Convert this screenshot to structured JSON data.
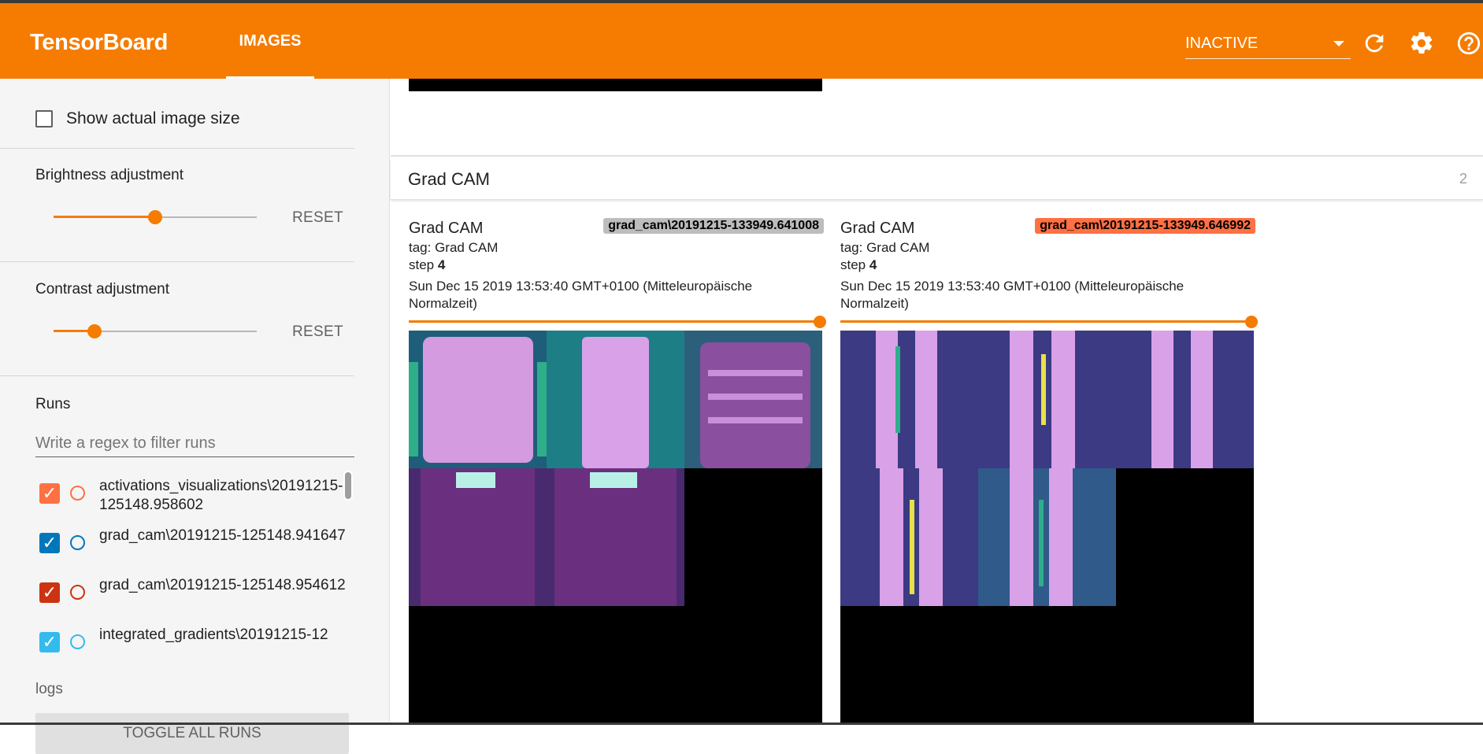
{
  "header": {
    "brand": "TensorBoard",
    "tabs": [
      {
        "label": "IMAGES",
        "active": true
      }
    ],
    "run_status": "INACTIVE",
    "icons": [
      "refresh-icon",
      "settings-icon",
      "help-icon"
    ],
    "colors": {
      "primary": "#f57c00",
      "on_primary": "#ffffff"
    }
  },
  "sidebar": {
    "show_actual_size_label": "Show actual image size",
    "show_actual_size_checked": false,
    "brightness": {
      "label": "Brightness adjustment",
      "reset": "RESET",
      "level": 0.5
    },
    "contrast": {
      "label": "Contrast adjustment",
      "reset": "RESET",
      "level": 0.2
    },
    "runs": {
      "title": "Runs",
      "filter_placeholder": "Write a regex to filter runs",
      "items": [
        {
          "label": "activations_visualizations\\20191215-125148.958602",
          "checked": true,
          "color": "#ff7043"
        },
        {
          "label": "grad_cam\\20191215-125148.941647",
          "checked": true,
          "color": "#0077bb"
        },
        {
          "label": "grad_cam\\20191215-125148.954612",
          "checked": true,
          "color": "#cc3311"
        },
        {
          "label": "integrated_gradients\\20191215-12",
          "checked": true,
          "color": "#33bbee"
        }
      ],
      "toggle_all": "TOGGLE ALL RUNS"
    },
    "logdir": "logs"
  },
  "main": {
    "group": {
      "title": "Grad CAM",
      "count": "2"
    },
    "cards": [
      {
        "title": "Grad CAM",
        "run": "grad_cam\\20191215-133949.641008",
        "run_color": "#bdbdbd",
        "tag_label": "tag: Grad CAM",
        "step_label": "step",
        "step_value": "4",
        "date": "Sun Dec 15 2019 13:53:40 GMT+0100 (Mitteleuropäische Normalzeit)",
        "step_level": 1.0,
        "image_icon": "clothing-grad-cam-grid"
      },
      {
        "title": "Grad CAM",
        "run": "grad_cam\\20191215-133949.646992",
        "run_color": "#ff7043",
        "tag_label": "tag: Grad CAM",
        "step_label": "step",
        "step_value": "4",
        "date": "Sun Dec 15 2019 13:53:40 GMT+0100 (Mitteleuropäische Normalzeit)",
        "step_level": 1.0,
        "image_icon": "trousers-grad-cam-grid"
      }
    ]
  }
}
